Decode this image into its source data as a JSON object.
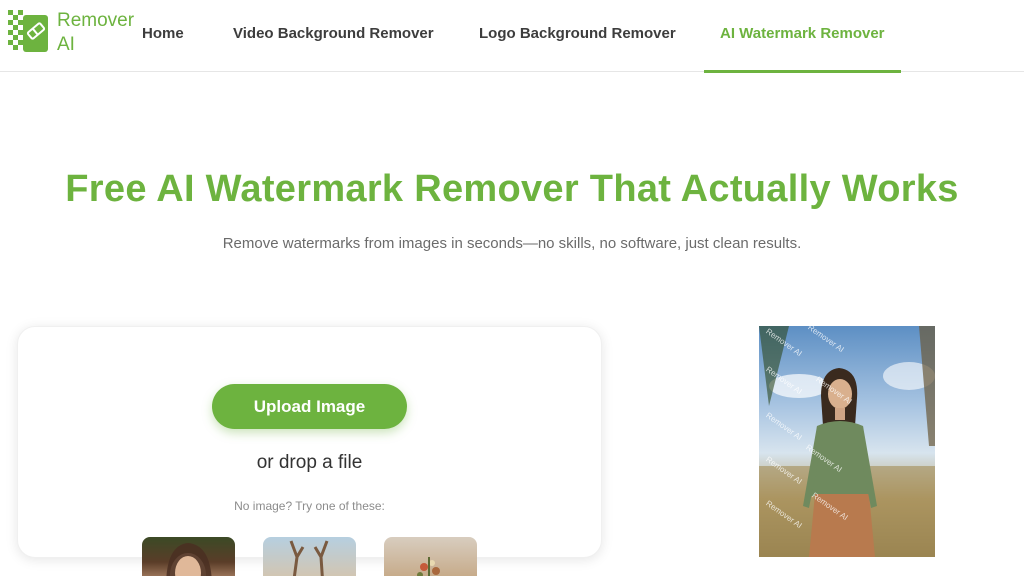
{
  "brand": {
    "line1": "Remover",
    "line2": "AI"
  },
  "nav": {
    "items": [
      {
        "label": "Home"
      },
      {
        "label": "Video Background Remover"
      },
      {
        "label": "Logo Background Remover"
      },
      {
        "label": "AI Watermark Remover"
      }
    ],
    "active_index": 3
  },
  "hero": {
    "title": "Free AI Watermark Remover That Actually Works",
    "subtitle": "Remove watermarks from images in seconds—no skills, no software, just clean results."
  },
  "upload": {
    "button_label": "Upload Image",
    "drop_text": "or drop a file",
    "try_text": "No image? Try one of these:"
  },
  "preview": {
    "watermark_text": "Remover AI"
  },
  "colors": {
    "accent": "#6db33f",
    "text": "#3d3d3d",
    "muted": "#6b6b6b"
  }
}
